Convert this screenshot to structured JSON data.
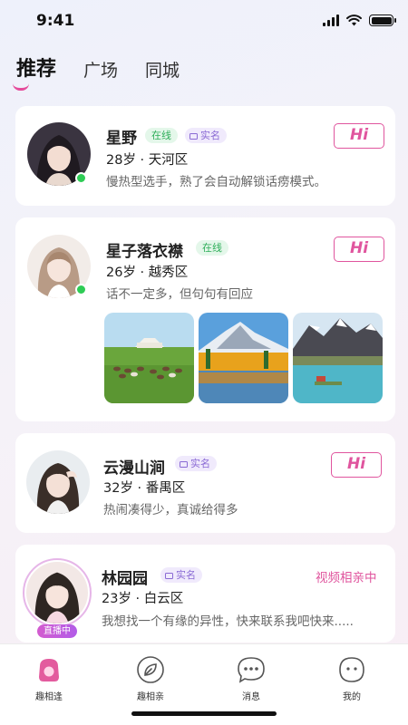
{
  "status_bar": {
    "time": "9:41"
  },
  "top_tabs": [
    {
      "label": "推荐",
      "active": true
    },
    {
      "label": "广场",
      "active": false
    },
    {
      "label": "同城",
      "active": false
    }
  ],
  "cards": [
    {
      "name": "星野",
      "online_badge": "在线",
      "verified_badge": "实名",
      "meta": "28岁 · 天河区",
      "bio": "慢热型选手，熟了会自动解锁话痨模式。",
      "action": "Hi",
      "online": true
    },
    {
      "name": "星子落衣襟",
      "online_badge": "在线",
      "meta": "26岁 · 越秀区",
      "bio": "话不一定多，但句句有回应",
      "action": "Hi",
      "online": true,
      "photos": [
        "grassland-yurt-photo",
        "autumn-lake-mountain-photo",
        "glacier-lake-photo"
      ]
    },
    {
      "name": "云漫山涧",
      "verified_badge": "实名",
      "meta": "32岁 · 番禺区",
      "bio": "热闹凑得少，真诚给得多",
      "action": "Hi"
    },
    {
      "name": "林园园",
      "verified_badge": "实名",
      "meta": "23岁 · 白云区",
      "bio": "我想找一个有缘的异性，快来联系我吧快来.....",
      "video_label": "视频相亲中",
      "live_badge": "直播中"
    }
  ],
  "bottom_tabs": [
    {
      "label": "趣相逢",
      "icon": "home-blob-icon",
      "active": true
    },
    {
      "label": "趣相亲",
      "icon": "leaf-icon",
      "active": false
    },
    {
      "label": "消息",
      "icon": "chat-bubble-icon",
      "active": false
    },
    {
      "label": "我的",
      "icon": "profile-face-icon",
      "active": false
    }
  ],
  "colors": {
    "accent": "#e0559e",
    "online": "#2ecc55",
    "verified": "#8a6ad4"
  }
}
